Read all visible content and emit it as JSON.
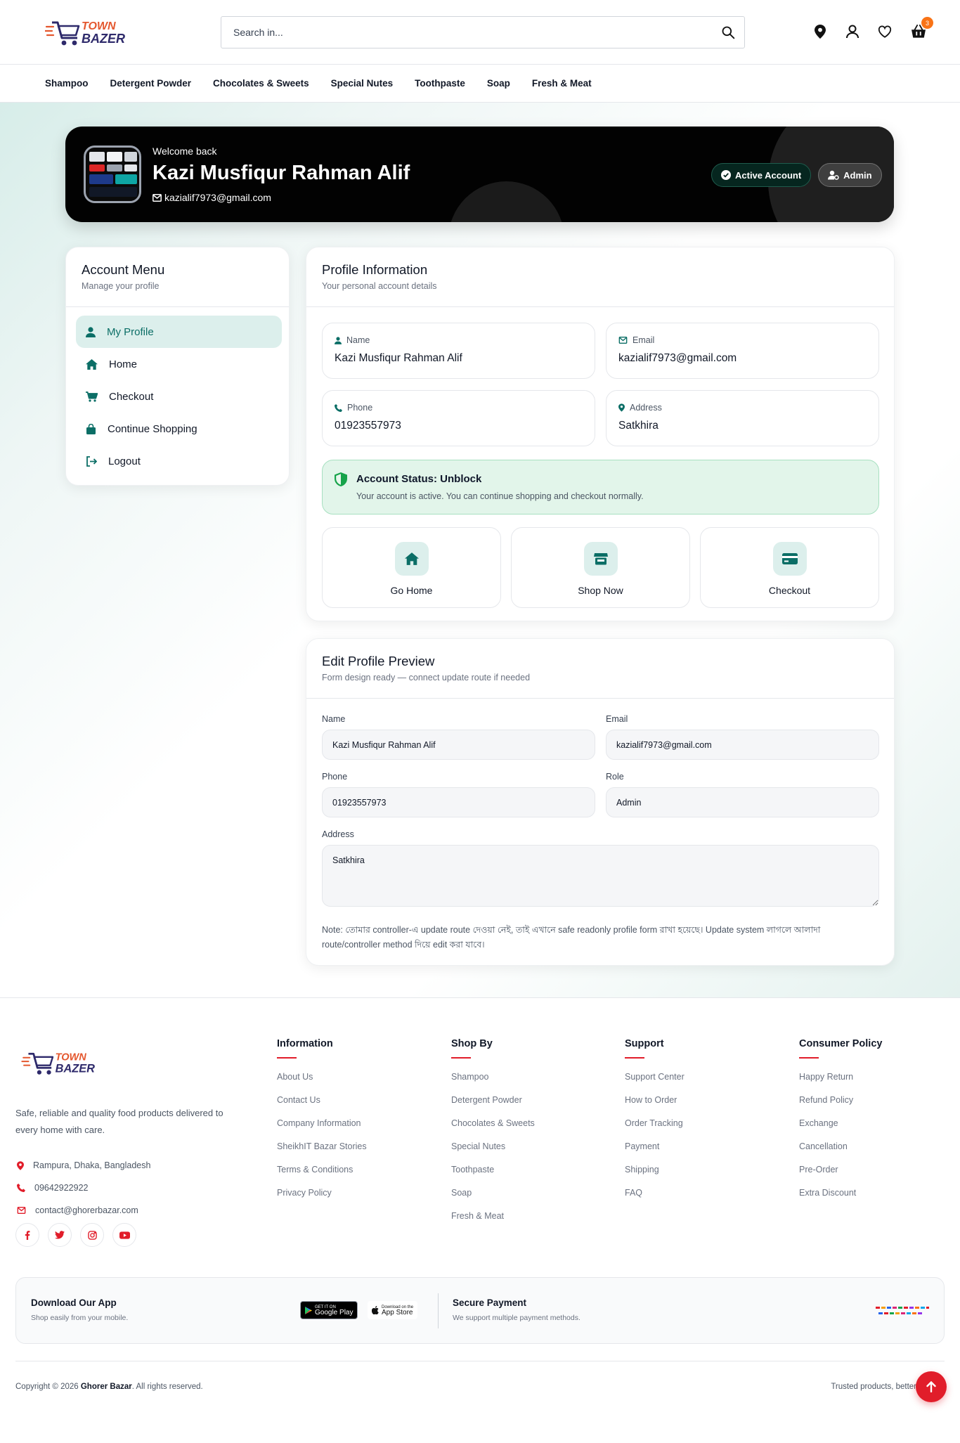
{
  "header": {
    "logo_word1": "TOWN",
    "logo_word2": "BAZER",
    "search_placeholder": "Search in...",
    "cart_count": "3",
    "icons": [
      "map-pin-icon",
      "user-icon",
      "heart-icon",
      "basket-icon"
    ]
  },
  "categories": [
    "Shampoo",
    "Detergent Powder",
    "Chocolates & Sweets",
    "Special Nutes",
    "Toothpaste",
    "Soap",
    "Fresh & Meat"
  ],
  "hero": {
    "welcome": "Welcome back",
    "name": "Kazi Musfiqur Rahman Alif",
    "email": "kazialif7973@gmail.com",
    "badge_active": "Active Account",
    "badge_role": "Admin"
  },
  "menu": {
    "title": "Account Menu",
    "subtitle": "Manage your profile",
    "items": [
      {
        "label": "My Profile",
        "icon": "user-icon"
      },
      {
        "label": "Home",
        "icon": "home-icon"
      },
      {
        "label": "Checkout",
        "icon": "cart-icon"
      },
      {
        "label": "Continue Shopping",
        "icon": "bag-icon"
      },
      {
        "label": "Logout",
        "icon": "logout-icon"
      }
    ]
  },
  "profile": {
    "title": "Profile Information",
    "subtitle": "Your personal account details",
    "fields": [
      {
        "label": "Name",
        "value": "Kazi Musfiqur Rahman Alif",
        "icon": "user-icon"
      },
      {
        "label": "Email",
        "value": "kazialif7973@gmail.com",
        "icon": "envelope-icon"
      },
      {
        "label": "Phone",
        "value": "01923557973",
        "icon": "phone-icon"
      },
      {
        "label": "Address",
        "value": "Satkhira",
        "icon": "map-pin-icon"
      }
    ],
    "status_title": "Account Status: Unblock",
    "status_text": "Your account is active. You can continue shopping and checkout normally.",
    "actions": [
      {
        "label": "Go Home",
        "icon": "home-icon"
      },
      {
        "label": "Shop Now",
        "icon": "store-icon"
      },
      {
        "label": "Checkout",
        "icon": "credit-card-icon"
      }
    ]
  },
  "edit": {
    "title": "Edit Profile Preview",
    "subtitle": "Form design ready — connect update route if needed",
    "name_label": "Name",
    "name_value": "Kazi Musfiqur Rahman Alif",
    "email_label": "Email",
    "email_value": "kazialif7973@gmail.com",
    "phone_label": "Phone",
    "phone_value": "01923557973",
    "role_label": "Role",
    "role_value": "Admin",
    "address_label": "Address",
    "address_value": "Satkhira",
    "note": "Note: তোমার controller-এ update route দেওয়া নেই, তাই এখানে safe readonly profile form রাখা হয়েছে। Update system লাগলে আলাদা route/controller method দিয়ে edit করা যাবে।"
  },
  "footer": {
    "description": "Safe, reliable and quality food products delivered to every home with care.",
    "address": "Rampura, Dhaka, Bangladesh",
    "phone": "09642922922",
    "email": "contact@ghorerbazar.com",
    "social": [
      "facebook-icon",
      "twitter-icon",
      "instagram-icon",
      "youtube-icon"
    ],
    "columns": [
      {
        "title": "Information",
        "links": [
          "About Us",
          "Contact Us",
          "Company Information",
          "SheikhIT Bazar Stories",
          "Terms & Conditions",
          "Privacy Policy"
        ]
      },
      {
        "title": "Shop By",
        "links": [
          "Shampoo",
          "Detergent Powder",
          "Chocolates & Sweets",
          "Special Nutes",
          "Toothpaste",
          "Soap",
          "Fresh & Meat"
        ]
      },
      {
        "title": "Support",
        "links": [
          "Support Center",
          "How to Order",
          "Order Tracking",
          "Payment",
          "Shipping",
          "FAQ"
        ]
      },
      {
        "title": "Consumer Policy",
        "links": [
          "Happy Return",
          "Refund Policy",
          "Exchange",
          "Cancellation",
          "Pre-Order",
          "Extra Discount"
        ]
      }
    ],
    "app_title": "Download Our App",
    "app_sub": "Shop easily from your mobile.",
    "gplay_small": "GET IT ON",
    "gplay_big": "Google Play",
    "appstore_small": "Download on the",
    "appstore_big": "App Store",
    "pay_title": "Secure Payment",
    "pay_sub": "We support multiple payment methods.",
    "copyright_pre": "Copyright © 2026 ",
    "copyright_brand": "Ghorer Bazar",
    "copyright_post": ". All rights reserved.",
    "trusted": "Trusted products, better"
  },
  "colors": {
    "accent": "#0b6e66",
    "accent_soft": "#dcefec",
    "red": "#e11d2a",
    "orange": "#f97316",
    "navy": "#2e2a6b"
  }
}
